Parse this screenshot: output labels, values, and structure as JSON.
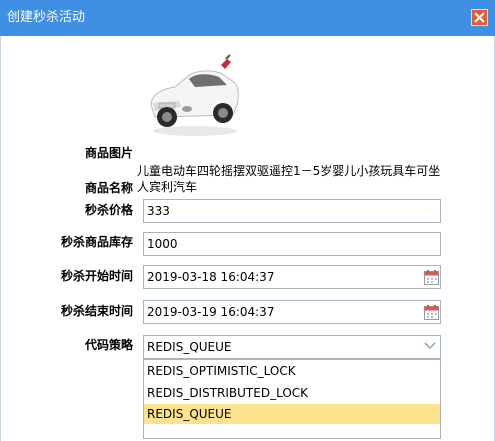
{
  "dialog": {
    "title": "创建秒杀活动"
  },
  "form": {
    "image_label": "商品图片",
    "name_label": "商品名称",
    "product_name": "儿童电动车四轮摇摆双驱遥控1－5岁婴儿小孩玩具车可坐人宾利汽车",
    "price_label": "秒杀价格",
    "price_value": "333",
    "stock_label": "秒杀商品库存",
    "stock_value": "1000",
    "start_label": "秒杀开始时间",
    "start_value": "2019-03-18 16:04:37",
    "end_label": "秒杀结束时间",
    "end_value": "2019-03-19 16:04:37",
    "strategy_label": "代码策略",
    "strategy_value": "REDIS_QUEUE",
    "strategy_options": [
      "REDIS_OPTIMISTIC_LOCK",
      "REDIS_DISTRIBUTED_LOCK",
      "REDIS_QUEUE"
    ]
  },
  "colors": {
    "titlebar": "#3f8fe3",
    "close_button": "#e25d3a",
    "selected_option": "#fde38e"
  },
  "icons": {
    "close": "close-icon",
    "calendar": "calendar-icon",
    "dropdown": "chevron-down-icon"
  }
}
